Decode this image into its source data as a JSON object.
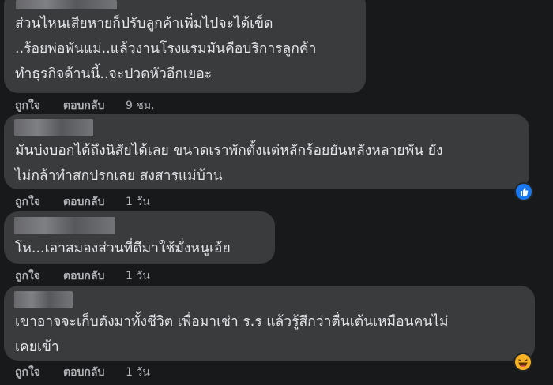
{
  "comments": [
    {
      "lines": [
        "ส่วนไหนเสียหายก็ปรับลูกค้าเพิ่มไปจะได้เข็ด",
        "..ร้อยพ่อพันแม่..แล้วงานโรงแรมมันคือบริการลูกค้า",
        "ทำธุรกิจด้านนี้..จะปวดหัวอีกเยอะ"
      ],
      "like": "ถูกใจ",
      "reply": "ตอบกลับ",
      "time": "9 ชม."
    },
    {
      "lines": [
        "มันบ่งบอกได้ถึงนิสัยได้เลย ขนาดเราพักตั้งแต่หลักร้อยยันหลังหลายพัน ยัง",
        "ไม่กล้าทำสกปรกเลย สงสารแม่บ้าน"
      ],
      "like": "ถูกใจ",
      "reply": "ตอบกลับ",
      "time": "1 วัน",
      "reaction": "like-icon"
    },
    {
      "lines": [
        "โห...เอาสมองส่วนที่ดีมาใช้มั่งหนูเอ้ย"
      ],
      "like": "ถูกใจ",
      "reply": "ตอบกลับ",
      "time": "1 วัน"
    },
    {
      "lines": [
        "เขาอาจจะเก็บตังมาทั้งชีวิต เพื่อมาเช่า ร.ร แล้วรู้สึกว่าตื่นเต้นเหมือนคนไม่",
        "เคยเข้า"
      ],
      "like": "ถูกใจ",
      "reply": "ตอบกลับ",
      "time": "1 วัน",
      "reaction": "haha-icon"
    }
  ],
  "colors": {
    "background": "#18191a",
    "bubble": "#3a3b3c",
    "text": "#e4e6eb",
    "secondary": "#b0b3b8",
    "like_blue": "#1877f2",
    "haha_yellow": "#f7b125"
  }
}
